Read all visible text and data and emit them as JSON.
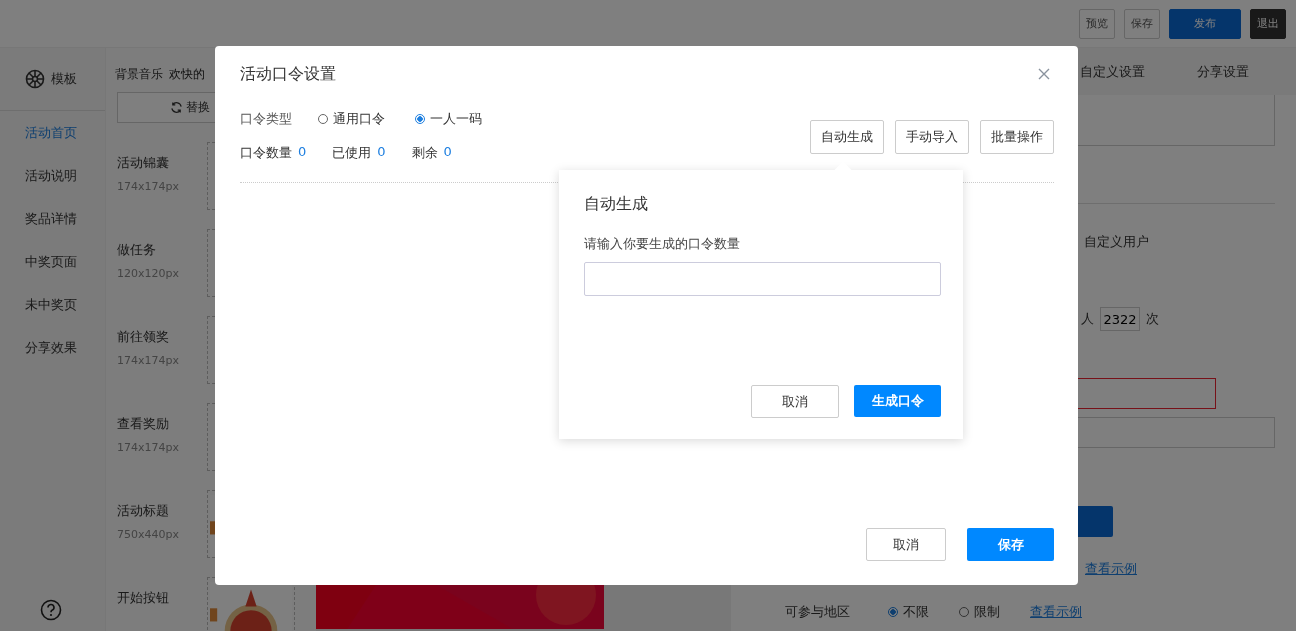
{
  "top_bar": {
    "buttons": [
      {
        "label": "预览",
        "kind": "plain"
      },
      {
        "label": "保存",
        "kind": "plain"
      },
      {
        "label": "发布",
        "kind": "primary"
      },
      {
        "label": "退出",
        "kind": "dark"
      }
    ]
  },
  "sidebar": {
    "header": "模板",
    "items": [
      {
        "label": "活动首页",
        "selected": true
      },
      {
        "label": "活动说明",
        "selected": false
      },
      {
        "label": "奖品详情",
        "selected": false
      },
      {
        "label": "中奖页面",
        "selected": false
      },
      {
        "label": "未中奖页",
        "selected": false
      },
      {
        "label": "分享效果",
        "selected": false
      }
    ]
  },
  "assets": {
    "music_label": "背景音乐",
    "music_value": "欢快的",
    "replace_button": "替换",
    "items": [
      {
        "name": "活动锦囊",
        "size": "174x174px",
        "has_image": false
      },
      {
        "name": "做任务",
        "size": "120x120px",
        "has_image": false
      },
      {
        "name": "前往领奖",
        "size": "174x174px",
        "has_image": false
      },
      {
        "name": "查看奖励",
        "size": "174x174px",
        "has_image": false
      },
      {
        "name": "活动标题",
        "size": "750x440px",
        "has_image": true
      },
      {
        "name": "开始按钮",
        "has_image": true
      }
    ]
  },
  "right_panel": {
    "tabs": [
      {
        "label": "自定义设置",
        "selected": false
      },
      {
        "label": "分享设置",
        "selected": false
      }
    ],
    "user_option": "自定义用户",
    "times_prefix": "人",
    "times_value": "2322",
    "times_suffix": "次",
    "link": "查看示例",
    "region": {
      "label": "可参与地区",
      "options": [
        {
          "label": "不限",
          "selected": true
        },
        {
          "label": "限制",
          "selected": false
        }
      ],
      "link": "查看示例"
    }
  },
  "dialog": {
    "title": "活动口令设置",
    "type_label": "口令类型",
    "type_options": [
      {
        "label": "通用口令",
        "selected": false
      },
      {
        "label": "一人一码",
        "selected": true
      }
    ],
    "stats": [
      {
        "label": "口令数量",
        "value": "0"
      },
      {
        "label": "已使用",
        "value": "0"
      },
      {
        "label": "剩余",
        "value": "0"
      }
    ],
    "actions": [
      "自动生成",
      "手动导入",
      "批量操作"
    ],
    "cancel": "取消",
    "save": "保存"
  },
  "popover": {
    "title": "自动生成",
    "label": "请输入你要生成的口令数量",
    "cancel": "取消",
    "confirm": "生成口令"
  }
}
